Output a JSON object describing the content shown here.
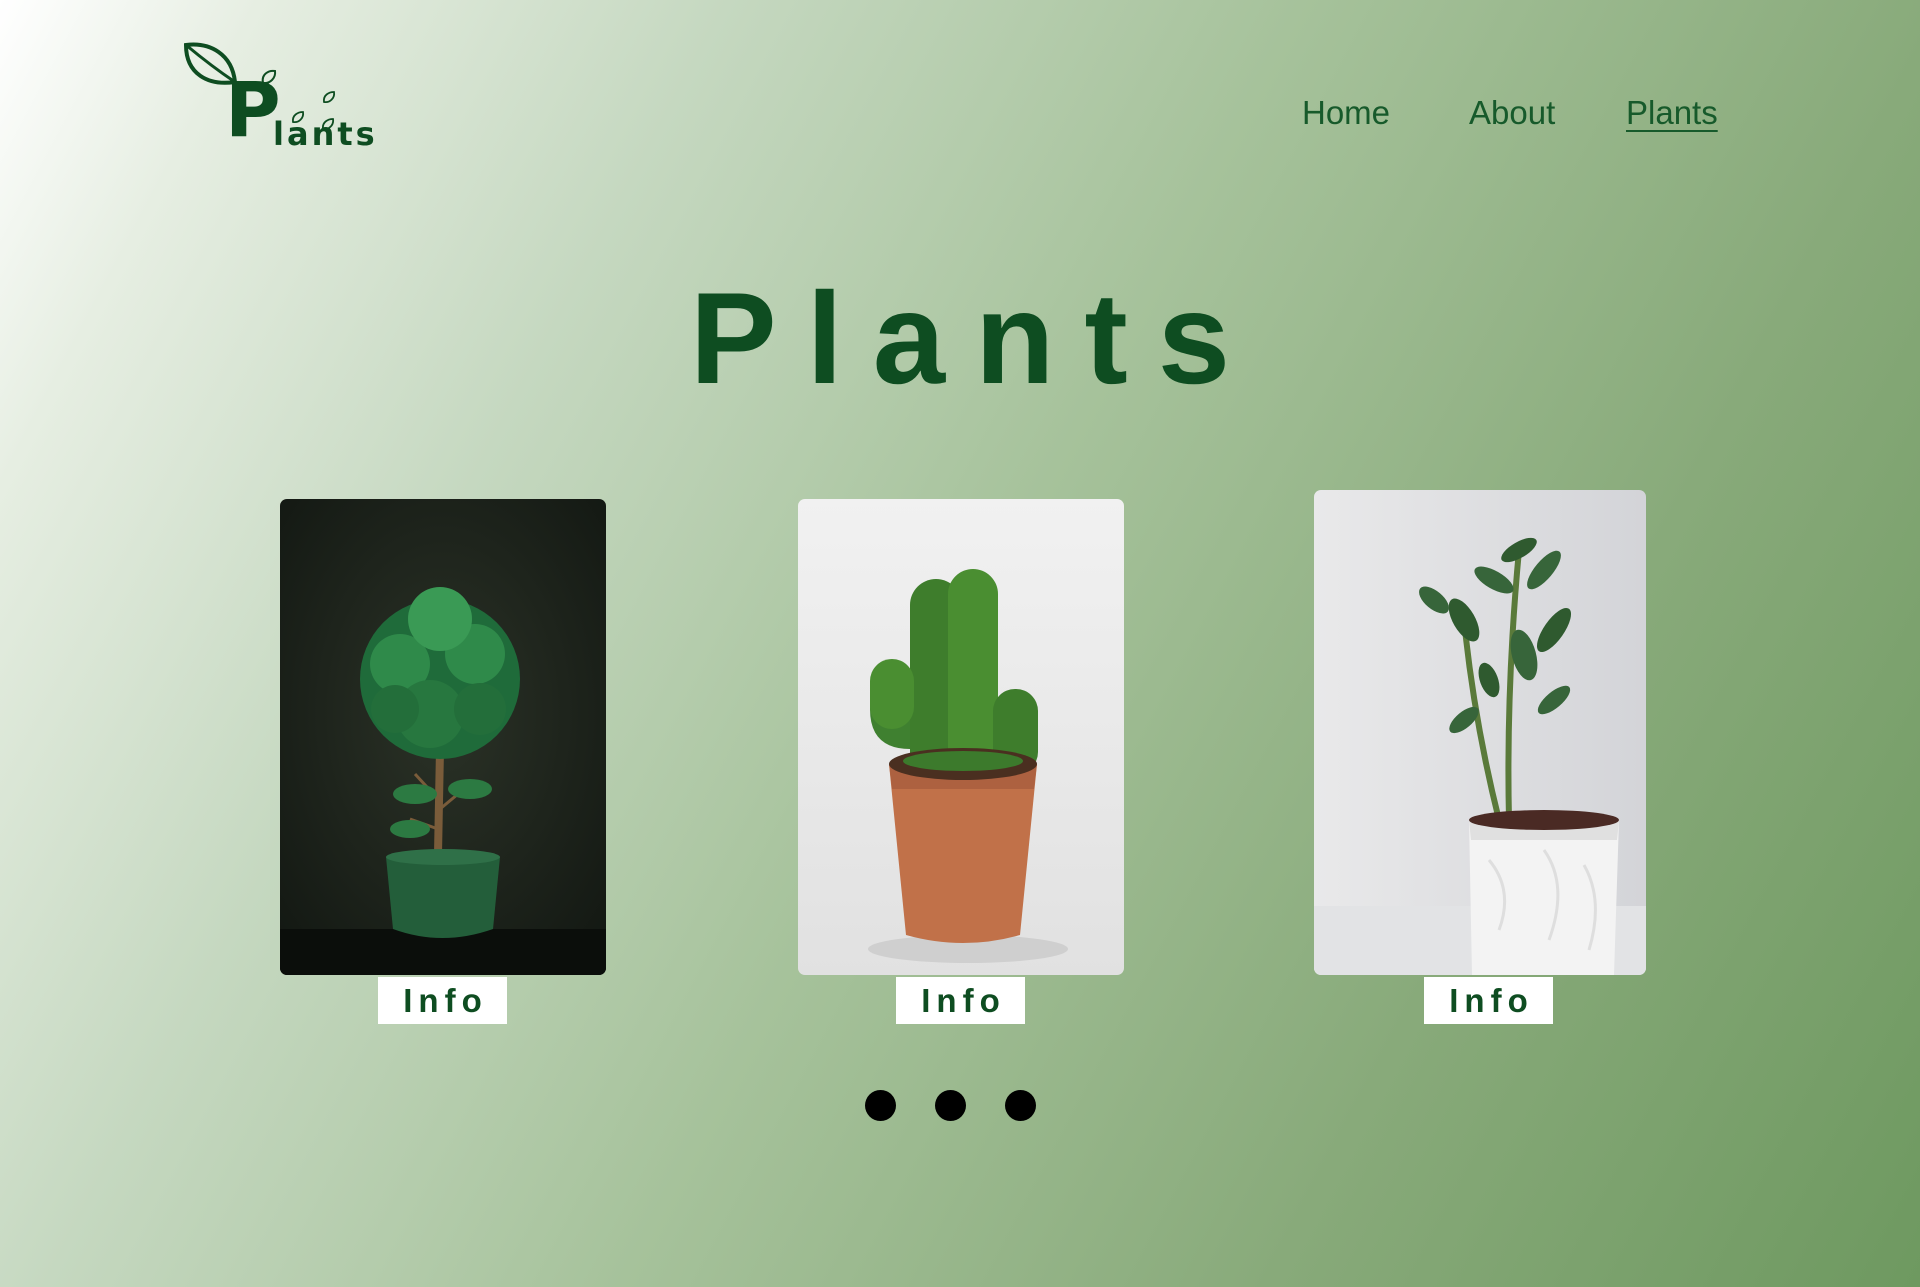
{
  "logo": {
    "initial": "P",
    "rest": "lants"
  },
  "nav": {
    "items": [
      {
        "label": "Home"
      },
      {
        "label": "About"
      },
      {
        "label": "Plants"
      }
    ],
    "active": "Plants"
  },
  "hero": {
    "title": "Plants"
  },
  "cards": [
    {
      "image": "topiary-tree-in-green-pot",
      "button_label": "Info"
    },
    {
      "image": "cactus-in-terracotta-pot",
      "button_label": "Info"
    },
    {
      "image": "zz-plant-in-white-pot",
      "button_label": "Info"
    }
  ],
  "carousel": {
    "dots": 3
  },
  "colors": {
    "primary_green": "#0e4d21",
    "nav_text": "#175a2b",
    "button_bg": "#ffffff",
    "dot": "#000000"
  }
}
